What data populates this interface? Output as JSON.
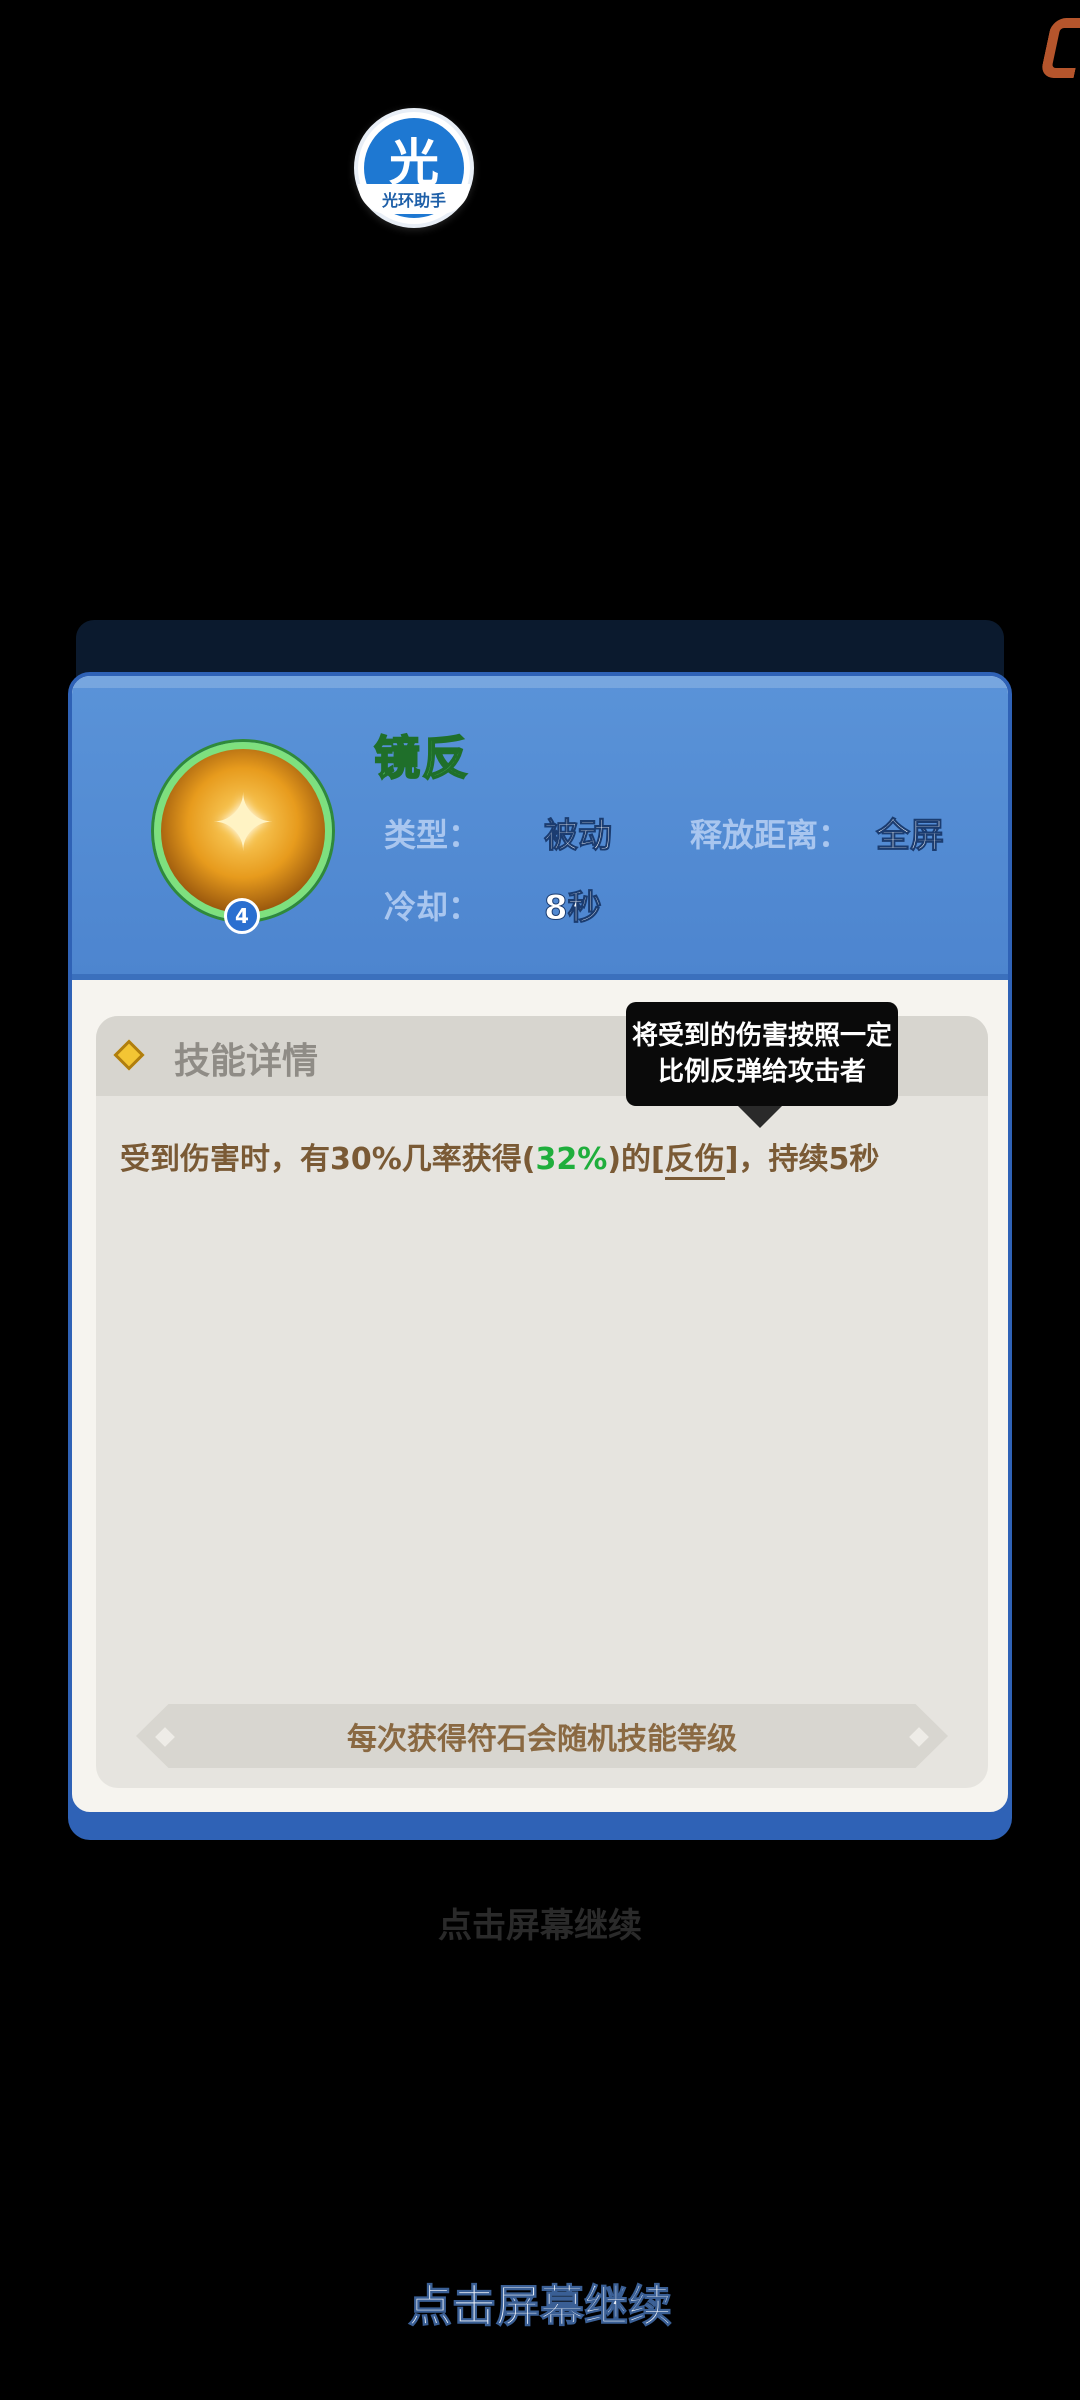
{
  "assistant": {
    "glyph": "光",
    "label": "光环助手"
  },
  "skill": {
    "name": "镜反",
    "level": "4",
    "icon": "mirror-staff-icon",
    "type_label": "类型：",
    "type_value": "被动",
    "range_label": "释放距离：",
    "range_value": "全屏",
    "cooldown_label": "冷却：",
    "cooldown_value": "8秒"
  },
  "details": {
    "title": "技能详情",
    "desc_prefix": "受到伤害时，有30%几率获得(",
    "desc_highlight": "32%",
    "desc_mid": ")的[",
    "desc_term": "反伤",
    "desc_suffix": "]，持续5秒",
    "tooltip_line1": "将受到的伤害按照一定",
    "tooltip_line2": "比例反弹给攻击者",
    "footer": "每次获得符石会随机技能等级"
  },
  "hints": {
    "faded": "点击屏幕继续",
    "main": "点击屏幕继续"
  },
  "colors": {
    "header_blue": "#5a93d8",
    "name_green": "#7df28a",
    "highlight_green": "#1fae3c",
    "desc_brown": "#7a5a35"
  }
}
